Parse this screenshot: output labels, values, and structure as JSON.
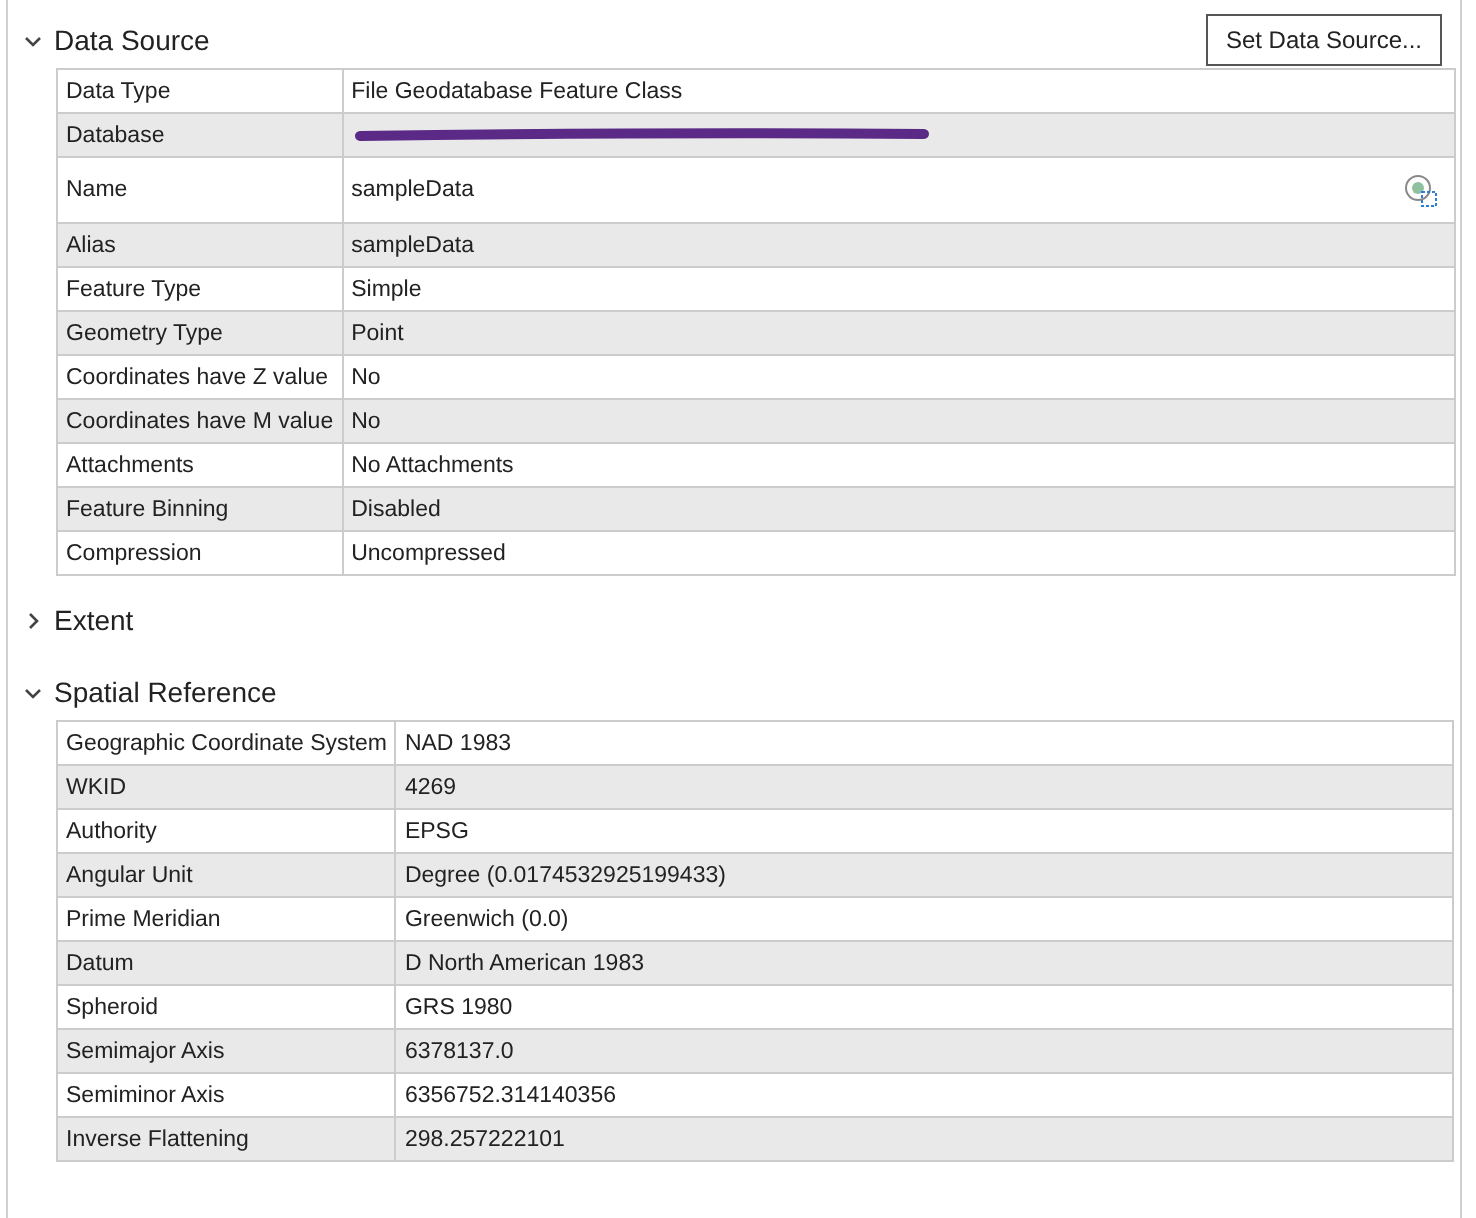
{
  "sections": [
    {
      "title": "Data Source",
      "expanded": true,
      "button": "Set Data Source...",
      "rows": [
        {
          "label": "Data Type",
          "value": "File Geodatabase Feature Class"
        },
        {
          "label": "Database",
          "redacted": true
        },
        {
          "label": "Name",
          "value": "sampleData",
          "has_icon": true
        },
        {
          "label": "Alias",
          "value": "sampleData"
        },
        {
          "label": "Feature Type",
          "value": "Simple"
        },
        {
          "label": "Geometry Type",
          "value": "Point"
        },
        {
          "label": "Coordinates have Z value",
          "value": "No"
        },
        {
          "label": "Coordinates have M value",
          "value": "No"
        },
        {
          "label": "Attachments",
          "value": "No Attachments"
        },
        {
          "label": "Feature Binning",
          "value": "Disabled"
        },
        {
          "label": "Compression",
          "value": "Uncompressed"
        }
      ]
    },
    {
      "title": "Extent",
      "expanded": false
    },
    {
      "title": "Spatial Reference",
      "expanded": true,
      "rows": [
        {
          "label": "Geographic Coordinate System",
          "value": "NAD 1983"
        },
        {
          "label": "WKID",
          "value": "4269"
        },
        {
          "label": "Authority",
          "value": "EPSG"
        },
        {
          "label": "Angular Unit",
          "value": "Degree (0.0174532925199433)"
        },
        {
          "label": "Prime Meridian",
          "value": "Greenwich (0.0)"
        },
        {
          "label": "Datum",
          "value": "D North American 1983"
        },
        {
          "label": "Spheroid",
          "value": "GRS 1980"
        },
        {
          "label": "Semimajor Axis",
          "value": "6378137.0"
        },
        {
          "label": "Semiminor Axis",
          "value": "6356752.314140356"
        },
        {
          "label": "Inverse Flattening",
          "value": "298.257222101"
        }
      ]
    }
  ]
}
